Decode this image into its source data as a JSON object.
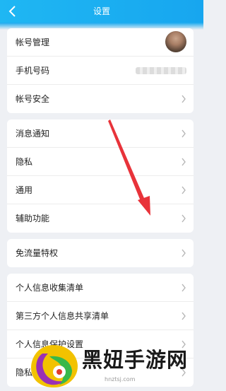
{
  "header": {
    "title": "设置"
  },
  "groups": [
    {
      "items": [
        {
          "label": "帐号管理"
        },
        {
          "label": "手机号码"
        },
        {
          "label": "帐号安全"
        }
      ]
    },
    {
      "items": [
        {
          "label": "消息通知"
        },
        {
          "label": "隐私"
        },
        {
          "label": "通用"
        },
        {
          "label": "辅助功能"
        }
      ]
    },
    {
      "items": [
        {
          "label": "免流量特权"
        }
      ]
    },
    {
      "items": [
        {
          "label": "个人信息收集清单"
        },
        {
          "label": "第三方个人信息共享清单"
        },
        {
          "label": "个人信息保护设置"
        },
        {
          "label": "隐私"
        }
      ]
    }
  ],
  "watermark": {
    "text": "黑妞手游网",
    "url": "hnztsj.com"
  },
  "colors": {
    "header": "#1fb7f3",
    "annotation_arrow": "#e8333a"
  },
  "icons": {
    "back": "chevron-left-icon",
    "row": "chevron-right-icon"
  }
}
